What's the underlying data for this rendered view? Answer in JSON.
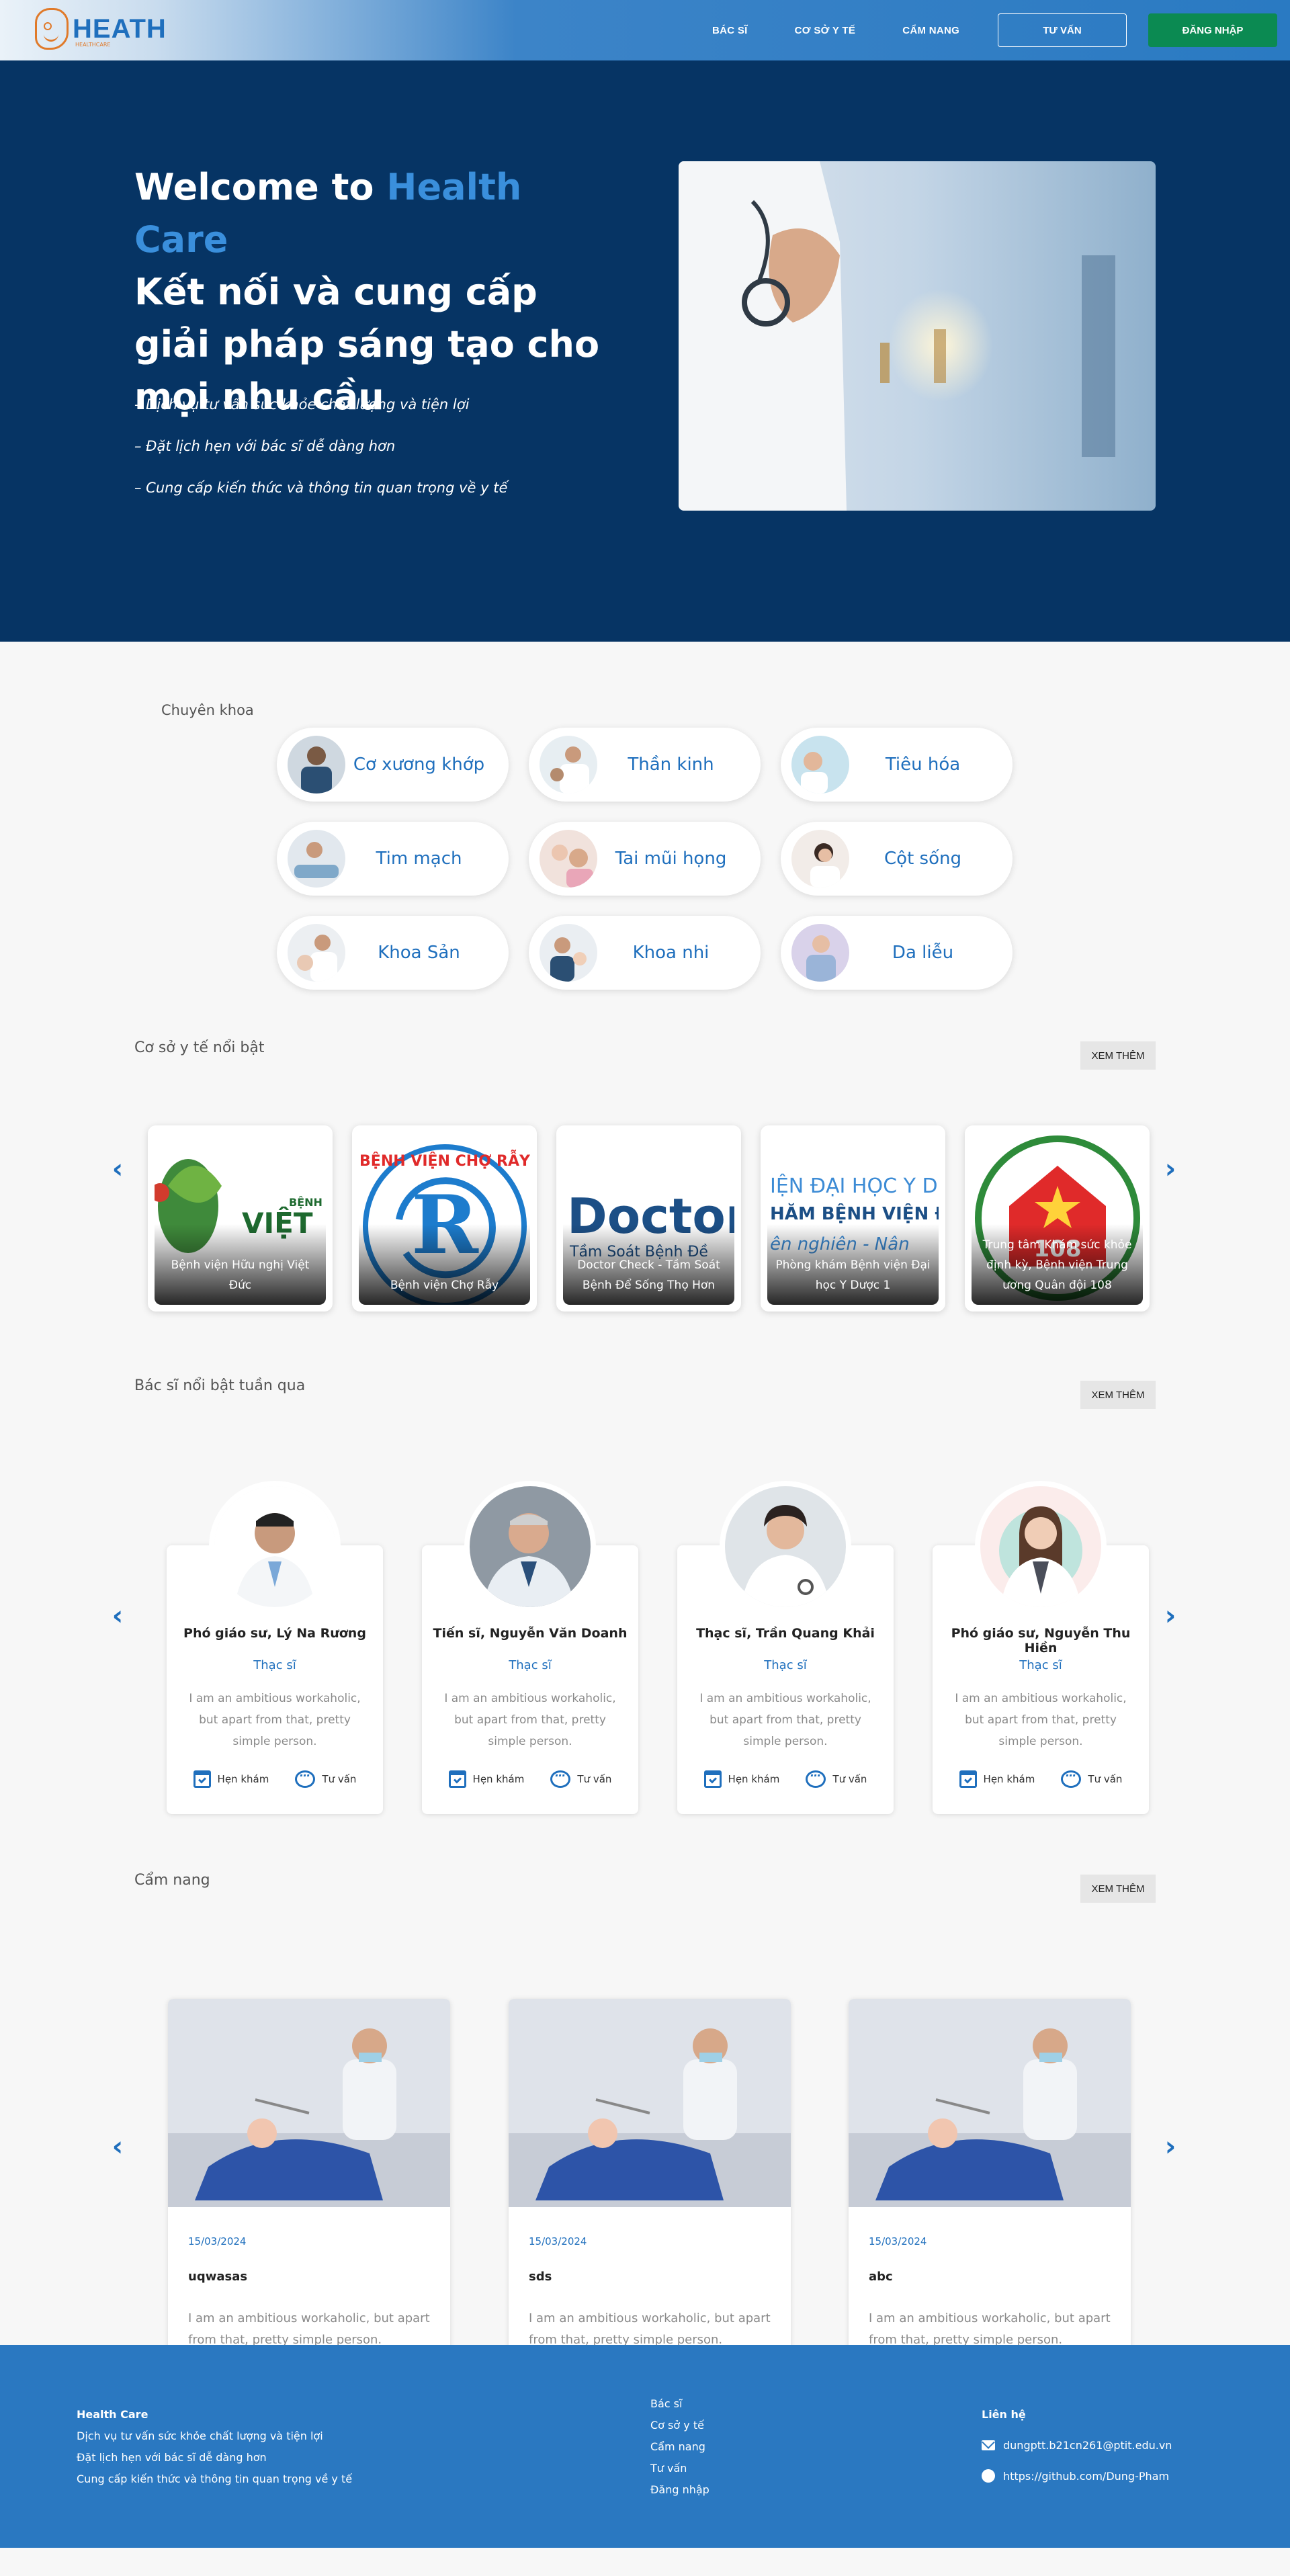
{
  "header": {
    "logo_text": "HEATH",
    "logo_sub": "HEALTHCARE",
    "nav": [
      "BÁC SĨ",
      "CƠ SỞ Y TẾ",
      "CẨM NANG"
    ],
    "consult_button": "TƯ VẤN",
    "login_button": "ĐĂNG NHẬP"
  },
  "hero": {
    "title_prefix": "Welcome to ",
    "title_accent": "Health Care",
    "title_rest": "Kết nối và cung cấp giải pháp sáng tạo cho mọi nhu cầu",
    "bullets": [
      "– Dịch vụ tư vấn sức khỏe chất lượng và tiện lợi",
      "– Đặt lịch hẹn với bác sĩ dễ dàng hơn",
      "– Cung cấp kiến thức và thông tin quan trọng về y tế"
    ]
  },
  "specialties": {
    "label": "Chuyên khoa",
    "items": [
      "Cơ xương khớp",
      "Thần kinh",
      "Tiêu hóa",
      "Tim mạch",
      "Tai mũi họng",
      "Cột sống",
      "Khoa Sản",
      "Khoa nhi",
      "Da liễu"
    ]
  },
  "facilities": {
    "label": "Cơ sở y tế nổi bật",
    "more": "XEM THÊM",
    "items": [
      "Bệnh viện Hữu nghị Việt Đức",
      "Bệnh viện Chợ Rẫy",
      "Doctor Check - Tầm Soát Bệnh Để Sống Thọ Hơn",
      "Phòng khám Bệnh viện Đại học Y Dược 1",
      "Trung tâm Khám sức khỏe định kỳ, Bệnh viện Trung ương Quân đội 108"
    ]
  },
  "doctors": {
    "label": "Bác sĩ nổi bật tuần qua",
    "more": "XEM THÊM",
    "book": "Hẹn khám",
    "consult": "Tư vấn",
    "items": [
      {
        "name": "Phó giáo sư, Lý Na Rương",
        "degree": "Thạc sĩ",
        "desc": "I am an ambitious workaholic, but apart from that, pretty simple person."
      },
      {
        "name": "Tiến sĩ, Nguyễn Văn Doanh",
        "degree": "Thạc sĩ",
        "desc": "I am an ambitious workaholic, but apart from that, pretty simple person."
      },
      {
        "name": "Thạc sĩ, Trần Quang Khải",
        "degree": "Thạc sĩ",
        "desc": "I am an ambitious workaholic, but apart from that, pretty simple person."
      },
      {
        "name": "Phó giáo sư, Nguyễn Thu Hiền",
        "degree": "Thạc sĩ",
        "desc": "I am an ambitious workaholic, but apart from that, pretty simple person."
      }
    ]
  },
  "handbook": {
    "label": "Cẩm nang",
    "more": "XEM THÊM",
    "items": [
      {
        "date": "15/03/2024",
        "title": "uqwasas",
        "desc": "I am an ambitious workaholic, but apart from that, pretty simple person."
      },
      {
        "date": "15/03/2024",
        "title": "sds",
        "desc": "I am an ambitious workaholic, but apart from that, pretty simple person."
      },
      {
        "date": "15/03/2024",
        "title": "abc",
        "desc": "I am an ambitious workaholic, but apart from that, pretty simple person."
      }
    ]
  },
  "footer": {
    "brand": "Health Care",
    "about": [
      "Dịch vụ tư vấn sức khỏe chất lượng và tiện lợi",
      "Đặt lịch hẹn với bác sĩ dễ dàng hơn",
      "Cung cấp kiến thức và thông tin quan trọng về y tế"
    ],
    "links": [
      "Bác sĩ",
      "Cơ sở y tế",
      "Cẩm nang",
      "Tư vấn",
      "Đăng nhập"
    ],
    "contact_title": "Liên hệ",
    "email": "dungptt.b21cn261@ptit.edu.vn",
    "github": "https://github.com/Dung-Pham"
  },
  "colors": {
    "primary": "#1f6fbd",
    "hero_bg": "#063464",
    "login_green": "#0b8a52",
    "footer_bg": "#2a78c1"
  }
}
